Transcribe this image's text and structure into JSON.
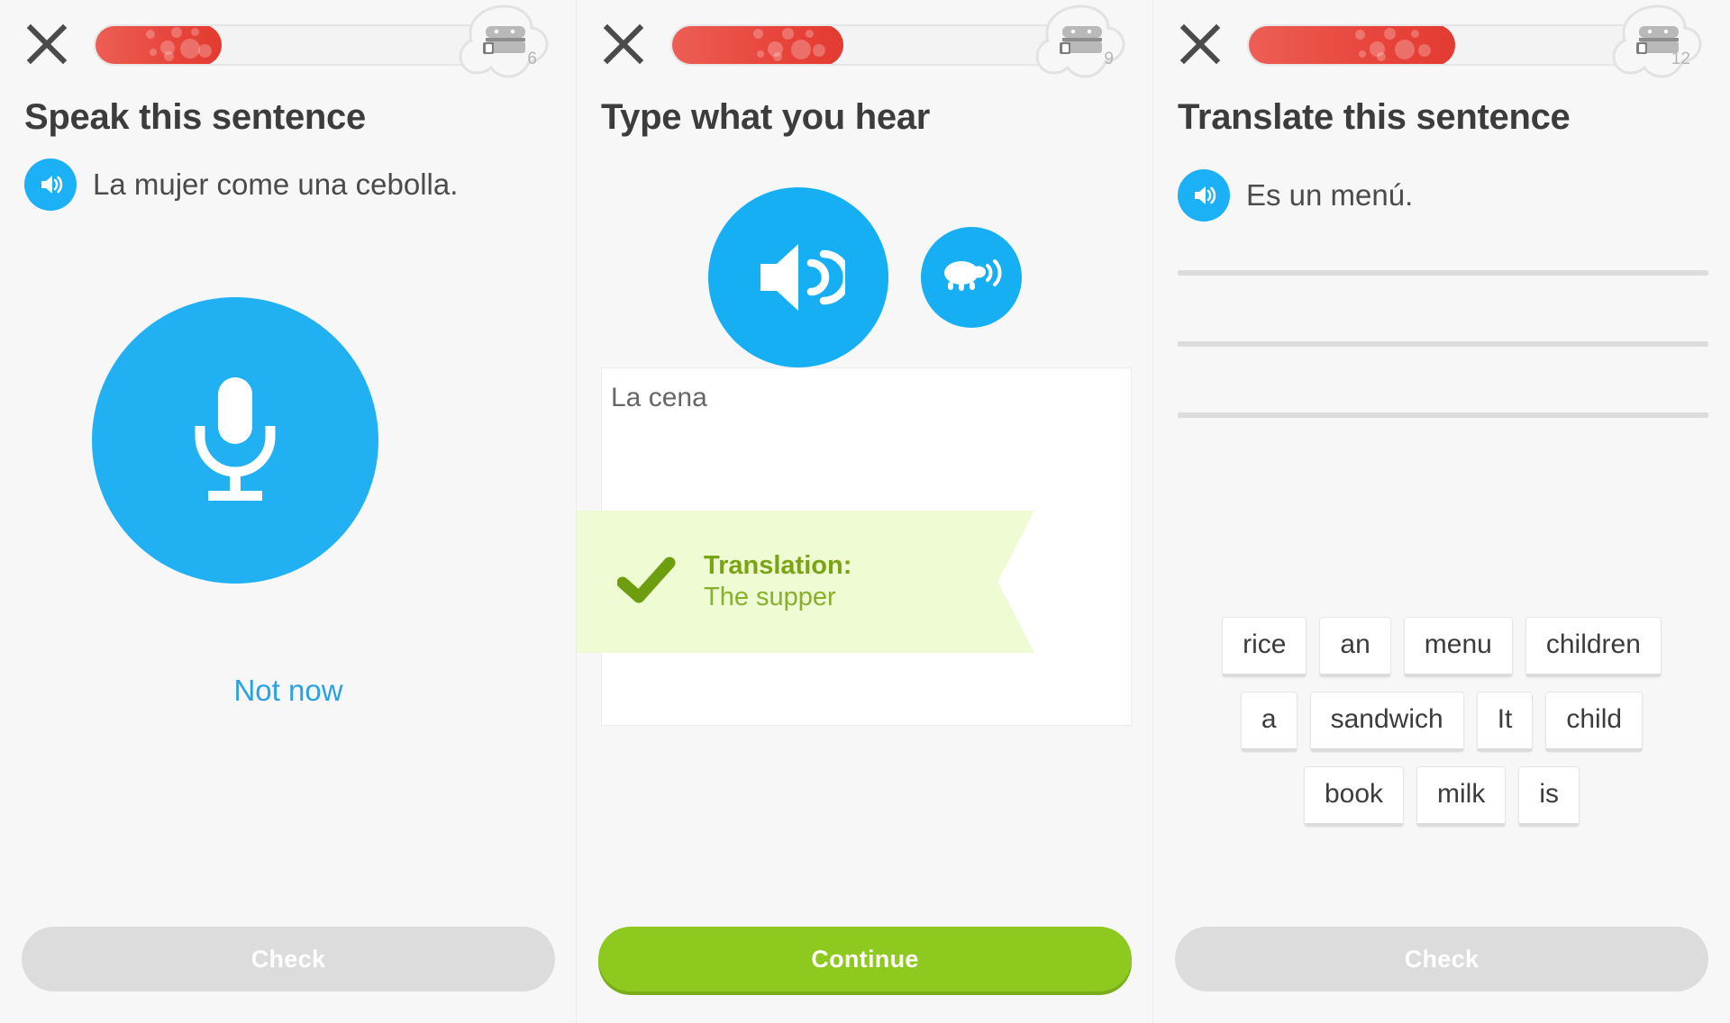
{
  "app": {
    "name": "Duolingo lesson exercises",
    "background_color": "#f7f7f7"
  },
  "colors": {
    "accent_blue": "#1cb0f6",
    "progress_red": "#e8453c",
    "green_button": "#8ec91f",
    "banner_bg": "#eefbd3",
    "banner_text": "#7aa512",
    "disabled_gray": "#dcdcdc",
    "title_text": "#3c3c3c"
  },
  "panels": [
    {
      "id": "speak",
      "close_icon": "close-icon",
      "progress": {
        "percent": 28,
        "chest_icon": "treasure-chest-icon",
        "chest_count": "6"
      },
      "title": "Speak this sentence",
      "speaker_icon": "speaker-icon",
      "sentence": "La mujer come una cebolla.",
      "mic_icon": "microphone-icon",
      "skip_link": "Not now",
      "button": {
        "label": "Check",
        "state": "disabled"
      }
    },
    {
      "id": "listen",
      "close_icon": "close-icon",
      "progress": {
        "percent": 38,
        "chest_icon": "treasure-chest-icon",
        "chest_count": "9"
      },
      "title": "Type what you hear",
      "speaker_icon": "speaker-icon",
      "slow_speaker_icon": "turtle-speaker-icon",
      "answer_value": "La cena",
      "banner": {
        "check_icon": "check-icon",
        "title": "Translation:",
        "body": "The supper"
      },
      "button": {
        "label": "Continue",
        "state": "active"
      }
    },
    {
      "id": "translate",
      "close_icon": "close-icon",
      "progress": {
        "percent": 46,
        "chest_icon": "treasure-chest-icon",
        "chest_count": "12"
      },
      "title": "Translate this sentence",
      "speaker_icon": "speaker-icon",
      "sentence": "Es un menú.",
      "answer_lines": 3,
      "word_bank": [
        [
          "rice",
          "an",
          "menu",
          "children"
        ],
        [
          "a",
          "sandwich",
          "It",
          "child"
        ],
        [
          "book",
          "milk",
          "is"
        ]
      ],
      "button": {
        "label": "Check",
        "state": "disabled"
      }
    }
  ]
}
